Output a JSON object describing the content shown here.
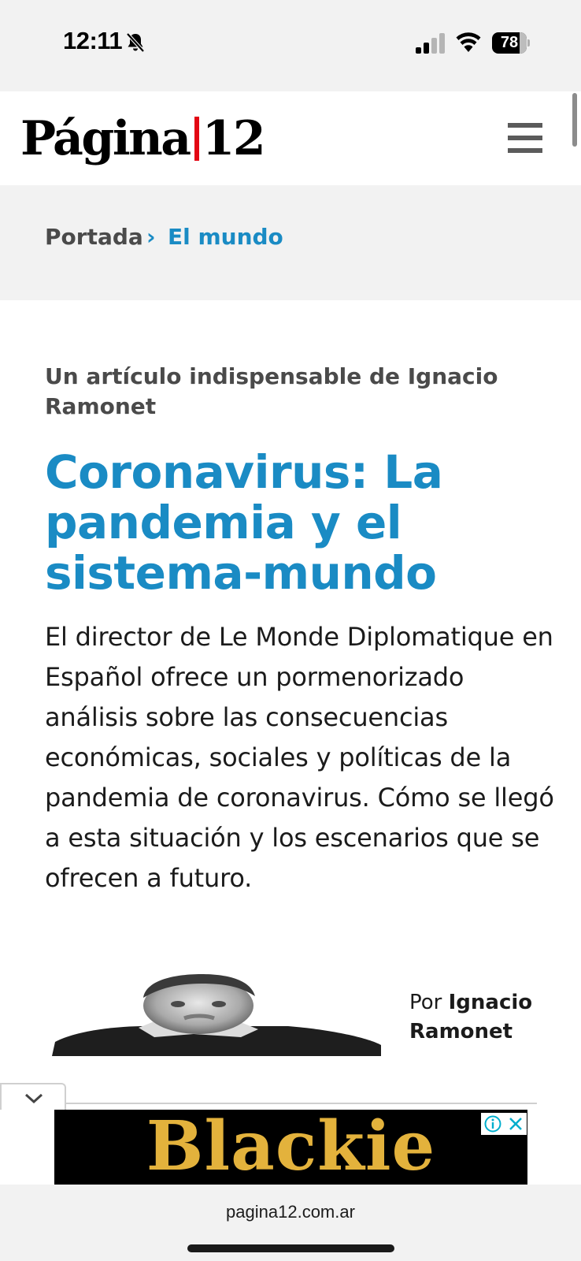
{
  "status_bar": {
    "time": "12:11",
    "battery_level": "78",
    "icons": [
      "bell-slash-icon",
      "cellular-signal-icon",
      "wifi-icon",
      "battery-icon"
    ]
  },
  "header": {
    "logo_left": "Página",
    "logo_right": "12",
    "logo_accent_color": "#e30613",
    "menu_icon": "hamburger-menu-icon"
  },
  "breadcrumb": {
    "home": "Portada",
    "separator": "›",
    "section": "El mundo"
  },
  "article": {
    "kicker": "Un artículo indispensable de Ignacio Ramonet",
    "headline": "Coronavirus: La pandemia y el sistema-mundo",
    "lede": "El director de Le Monde Diplomatique en Español ofrece un pormenorizado análisis sobre las consecuencias económicas, sociales y políticas de la pandemia de coronavirus. Cómo se llegó a esta situación y los escenarios que se ofrecen a futuro.",
    "byline_prefix": "Por",
    "byline_author": "Ignacio Ramonet"
  },
  "ad": {
    "text": "Blackie",
    "text_color": "#e3b23c",
    "icons": [
      "info-icon",
      "close-icon"
    ]
  },
  "browser": {
    "url": "pagina12.com.ar"
  },
  "colors": {
    "brand_blue": "#1a8bc4",
    "logo_red": "#e30613"
  }
}
